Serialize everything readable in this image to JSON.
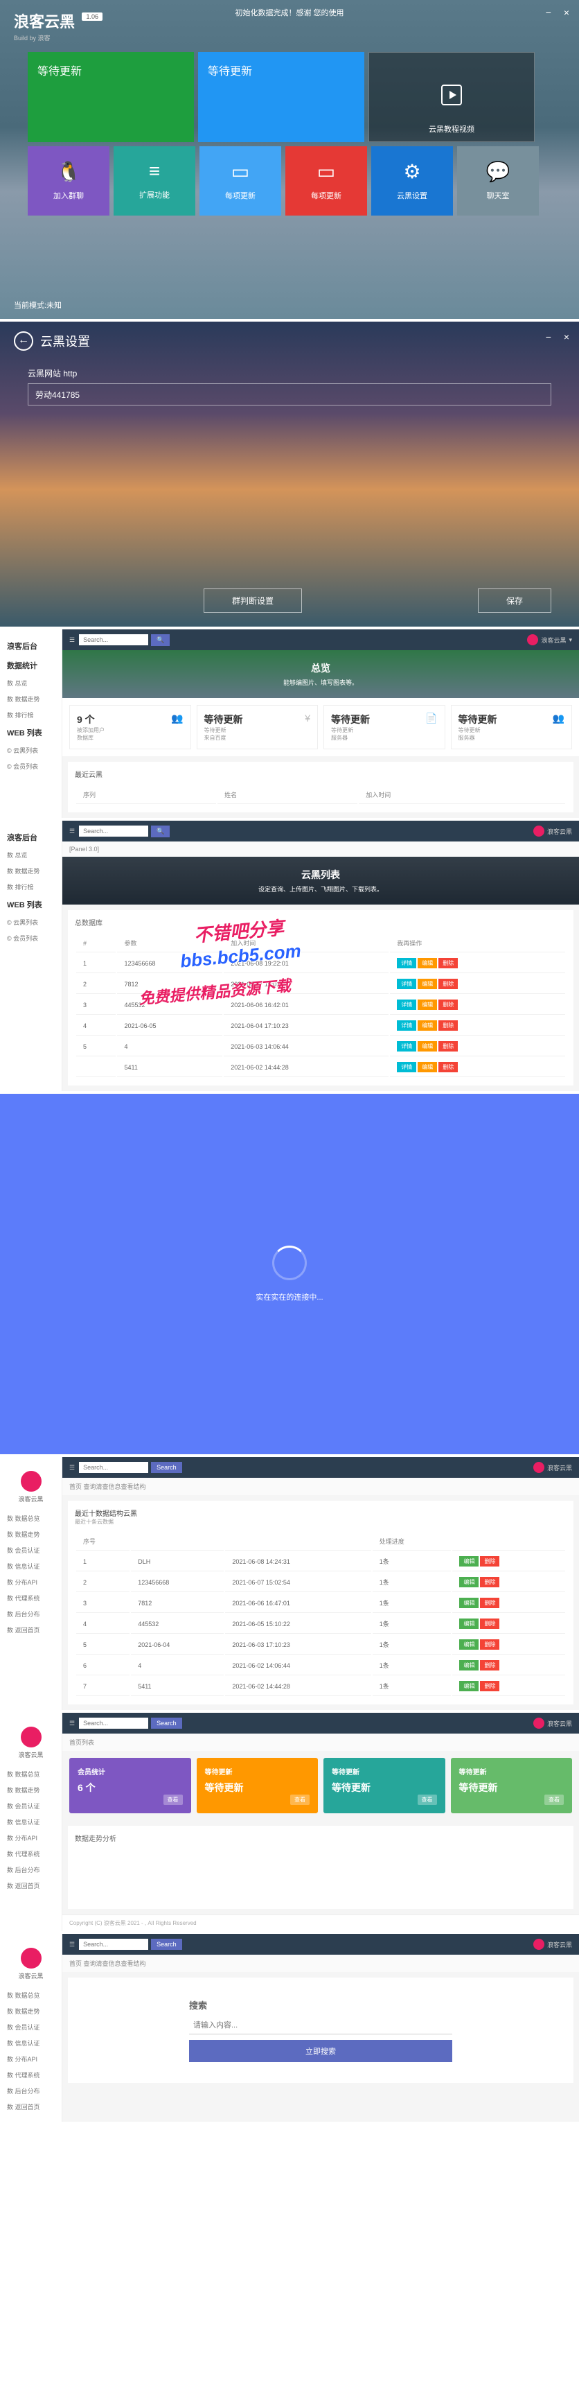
{
  "p1": {
    "title": "浪客云黑",
    "version": "1.06",
    "subtitle": "Build by 浪客",
    "top_msg": "初始化数据完成！感谢   您的使用",
    "tile1": "等待更新",
    "tile2": "等待更新",
    "tile3": "云黑教程视频",
    "sm": [
      "加入群聊",
      "扩展功能",
      "每项更新",
      "每项更新",
      "云黑设置",
      "聊天室"
    ],
    "footer": "当前模式:未知"
  },
  "p2": {
    "title": "云黑设置",
    "label": "云黑网站    http",
    "value": "劳动441785",
    "btn1": "群判断设置",
    "btn2": "保存"
  },
  "p3": {
    "brand": "浪客后台",
    "search_ph": "Search...",
    "user": "浪客云黑",
    "side_h1": "数据统计",
    "side": [
      "数 总览",
      "数 数据走势",
      "数 排行榜"
    ],
    "side_h2": "WEB 列表",
    "side2": [
      "© 云黑列表",
      "© 会员列表"
    ],
    "hero_t": "总览",
    "hero_s": "能够编图片、填写图表等。",
    "cards": [
      {
        "v": "9 个",
        "l": "被添加用户",
        "s": "数据库"
      },
      {
        "v": "等待更新",
        "l": "等待更新",
        "s": "来自百度"
      },
      {
        "v": "等待更新",
        "l": "等待更新",
        "s": "服务器"
      },
      {
        "v": "等待更新",
        "l": "等待更新",
        "s": "服务器"
      }
    ],
    "tbl_h": "最近云黑",
    "cols": [
      "序列",
      "",
      "姓名",
      "",
      "加入时间"
    ]
  },
  "p4": {
    "brand": "浪客后台",
    "crumb": "[Panel 3.0]",
    "hero_t": "云黑列表",
    "hero_s": "设定查询、上传图片、飞翔图片、下载列表。",
    "sec": "总数据库",
    "cols": [
      "#",
      "参数",
      "加入时间",
      "我再操作"
    ],
    "rows": [
      {
        "n": "1",
        "p": "123456668",
        "t": "2021-06-08 19:22:01"
      },
      {
        "n": "2",
        "p": "7812",
        "t": "2021-06-07 15:01:48"
      },
      {
        "n": "3",
        "p": "445532",
        "t": "2021-06-06 16:42:01"
      },
      {
        "n": "4",
        "p": "2021-06-05",
        "t": "2021-06-04 17:10:23"
      },
      {
        "n": "5",
        "p": "4",
        "t": "2021-06-03 14:06:44"
      },
      {
        "n": "",
        "p": "5411",
        "t": "2021-06-02 14:44:28"
      }
    ],
    "btns": [
      "详情",
      "编辑",
      "删除"
    ]
  },
  "wm": {
    "l1": "不错吧分享",
    "l2": "bbs.bcb5.com",
    "l3": "免费提供精品资源下载"
  },
  "p5": {
    "txt": "实在实在的连接中..."
  },
  "p6": {
    "brand": "浪客云黑",
    "user": "浪客云黑",
    "side": [
      "数 数据总览",
      "数 数据走势",
      "数 会员认证",
      "数 信息认证",
      "数 分布API",
      "数 代理系统",
      "数 后台分布",
      "数 返回首页"
    ],
    "crumb": "首页     查询清查信息查看结构",
    "sec": "最近十数据结构云黑",
    "sub": "最近十条云数据",
    "cols": [
      "序号",
      "",
      "",
      "处理进度",
      ""
    ],
    "rows": [
      {
        "a": "1",
        "b": "DLH",
        "c": "2021-06-08 14:24:31",
        "d": "1条"
      },
      {
        "a": "2",
        "b": "123456668",
        "c": "2021-06-07 15:02:54",
        "d": "1条"
      },
      {
        "a": "3",
        "b": "7812",
        "c": "2021-06-06 16:47:01",
        "d": "1条"
      },
      {
        "a": "4",
        "b": "445532",
        "c": "2021-06-05 15:10:22",
        "d": "1条"
      },
      {
        "a": "5",
        "b": "2021-06-04",
        "c": "2021-06-03 17:10:23",
        "d": "1条"
      },
      {
        "a": "6",
        "b": "4",
        "c": "2021-06-02 14:06:44",
        "d": "1条"
      },
      {
        "a": "7",
        "b": "5411",
        "c": "2021-06-02 14:44:28",
        "d": "1条"
      }
    ],
    "btns": [
      "编辑",
      "删除"
    ]
  },
  "p7": {
    "crumb": "首页列表",
    "cards": [
      {
        "t": "会员统计",
        "v": "6 个"
      },
      {
        "t": "等待更新",
        "v": "等待更新"
      },
      {
        "t": "等待更新",
        "v": "等待更新"
      },
      {
        "t": "等待更新",
        "v": "等待更新"
      }
    ],
    "btn": "查看",
    "sec": "数据走势分析",
    "foot": "Copyright (C) 浪客云黑 2021 - , All Rights Reserved"
  },
  "p8": {
    "crumb": "首页     查询清查信息查看结构",
    "title": "搜索",
    "ph": "请输入内容...",
    "btn": "立即搜索"
  },
  "common": {
    "search": "Search",
    "min": "−",
    "close": "×",
    "back": "←"
  }
}
